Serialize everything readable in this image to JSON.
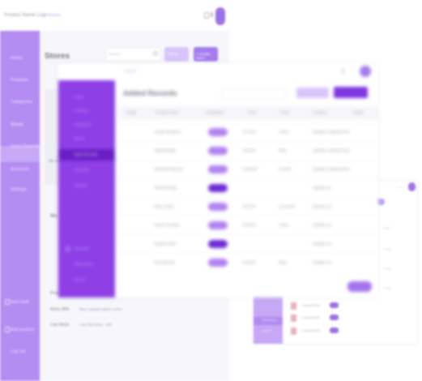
{
  "back_window": {
    "app_logo": "Product Name Logo",
    "header_search": "Search",
    "page_title": "Stores",
    "search_placeholder": "Search",
    "filter_label": "Filters",
    "create_button": "+ Create Store",
    "card_label": "Ble Voor",
    "section_title": "Mo",
    "sidebar": {
      "items": [
        {
          "label": "Home"
        },
        {
          "label": "Products"
        },
        {
          "label": "Categories"
        },
        {
          "label": "Stores",
          "active": true
        },
        {
          "label": "Sales Records"
        },
        {
          "label": "Accounts"
        },
        {
          "label": "Settings"
        }
      ],
      "bottom_items": [
        {
          "label": "Add Staff"
        },
        {
          "label": "Add product"
        },
        {
          "label": "Log out"
        }
      ]
    },
    "stats": [
      {
        "label": "Prod",
        "value": ""
      },
      {
        "label": "Items 20%",
        "value": "Brw Lorenelo seem | rems"
      },
      {
        "label": "Low Stock",
        "value": "Low Tew Ieton - 403"
      }
    ]
  },
  "front_window": {
    "page_title": "Added Records",
    "header_search": "Search",
    "table": {
      "headers": [
        "Image",
        "Product Name",
        "Categories",
        "Price",
        "Stock",
        "Location",
        "Status"
      ],
      "rows": [
        {
          "name": "Luxury Necklace",
          "status": "light",
          "price": "$ 70.00",
          "stock": "Active",
          "loc": "Sample Locations here"
        },
        {
          "name": "Gold Bracelet",
          "status": "light",
          "price": "$ 45.00",
          "stock": "Ring",
          "loc": "Sample Locations here"
        },
        {
          "name": "Diamond Ring Set",
          "status": "light",
          "price": "$ 120.00",
          "stock": "In stock",
          "loc": "Sample Locations here"
        },
        {
          "name": "Pearl Earrings",
          "status": "dark",
          "price": "",
          "stock": "",
          "loc": "Sample Loc"
        },
        {
          "name": "Silver Chain",
          "status": "light",
          "price": "$ 70.00",
          "stock": "Low stock",
          "loc": "Sample Loc"
        },
        {
          "name": "Charm Pendant",
          "status": "light",
          "price": "$ 45.00",
          "stock": "Active",
          "loc": "Sample Loc"
        },
        {
          "name": "Crystal Anklet",
          "status": "dark",
          "price": "",
          "stock": "",
          "loc": "Sample Loc"
        },
        {
          "name": "Rose Brooch",
          "status": "light",
          "price": "$ 45.00",
          "stock": "Ring",
          "loc": "Sample Loc"
        }
      ]
    },
    "sidebar": {
      "items": [
        {
          "label": "Home"
        },
        {
          "label": "Products"
        },
        {
          "label": "Categories"
        },
        {
          "label": "Stores"
        },
        {
          "label": "Sales Records",
          "active": true
        },
        {
          "label": "Accounts"
        },
        {
          "label": "Settings"
        }
      ],
      "bottom_items": [
        {
          "label": "Add Staff"
        },
        {
          "label": "Add product"
        },
        {
          "label": "Log out"
        }
      ]
    }
  },
  "small_window": {
    "rows": [
      {
        "name": "Luxury Set 01"
      },
      {
        "name": "Luxury Set 02"
      },
      {
        "name": "Luxury Set 03"
      }
    ],
    "sidebar_bottom": [
      {
        "label": "Add product"
      },
      {
        "label": "Log out"
      }
    ]
  },
  "colors": {
    "accent": "#8e3fe6",
    "accent_light": "#b48cf2",
    "accent_dark": "#6a1fc4"
  }
}
